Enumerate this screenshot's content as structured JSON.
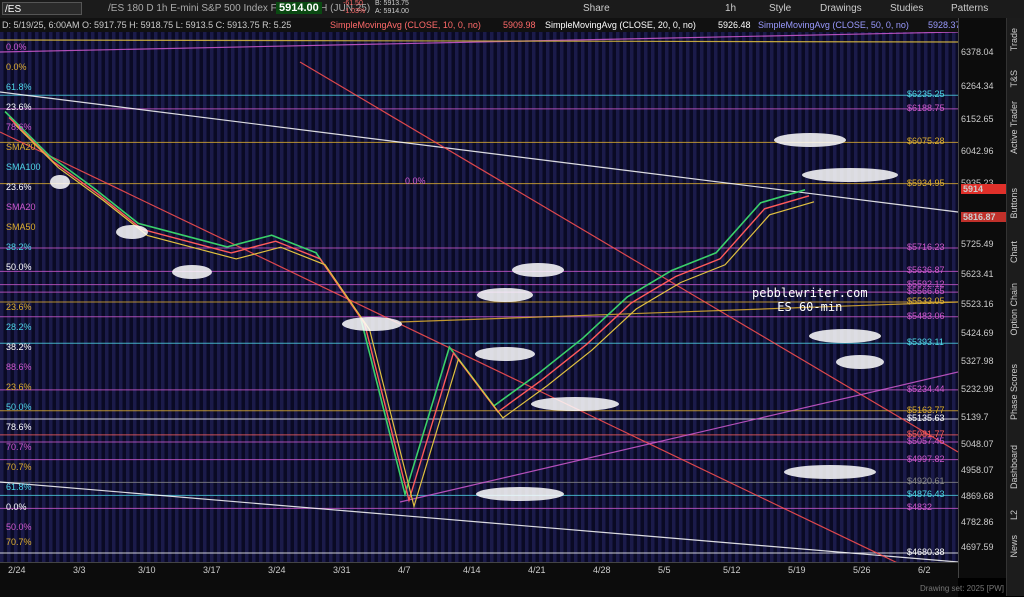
{
  "toolbar": {
    "symbol": "/ES",
    "description": "/ES 180 D 1h  E-mini S&P 500 Index Futures,ETH (JUN 25)",
    "last": "5914.00",
    "change": "-61.50",
    "change_pct": "-1.03%",
    "bid": "B: 5913.75",
    "ask": "A: 5914.00",
    "buttons": [
      "Share",
      "1h",
      "Style",
      "Drawings",
      "Studies",
      "Patterns"
    ]
  },
  "legend": {
    "ohlc": "D: 5/19/25, 6:00AM  O: 5917.75  H: 5918.75  L: 5913.5  C: 5913.75  R: 5.25",
    "sma10": "SimpleMovingAvg (CLOSE, 10, 0, no)",
    "sma10_val": "5909.98",
    "sma20": "SimpleMovingAvg (CLOSE, 20, 0, no)",
    "sma20_val": "5926.48",
    "sma50": "SimpleMovingAvg (CLOSE, 50, 0, no)",
    "sma50_val": "5928.37"
  },
  "chart_data": {
    "type": "line",
    "title": "/ES 180 D 1h",
    "x_ticks": [
      "2/24",
      "3/3",
      "3/10",
      "3/17",
      "3/24",
      "3/31",
      "4/7",
      "4/14",
      "4/21",
      "4/28",
      "5/5",
      "5/12",
      "5/19",
      "5/26",
      "6/2"
    ],
    "y_ticks": [
      "6378.04",
      "6264.34",
      "6152.65",
      "6042.96",
      "5935.23",
      "5725.49",
      "5623.41",
      "5523.16",
      "5424.69",
      "5327.98",
      "5232.99",
      "5139.7",
      "5048.07",
      "4958.07",
      "4869.68",
      "4782.86",
      "4697.59"
    ],
    "ylim": [
      4650,
      6450
    ],
    "series": [
      {
        "values": [
          6180,
          6030,
          5920,
          5800,
          5760,
          5720,
          5760,
          5700,
          5480,
          4880,
          5380,
          5180,
          5290,
          5410,
          5550,
          5640,
          5700,
          5870,
          5914
        ]
      }
    ],
    "levels": [
      {
        "label": "$6235.25",
        "value": 6235.25,
        "color": "#4fd6e8"
      },
      {
        "label": "$6188.75",
        "value": 6188.75,
        "color": "#d05ad0"
      },
      {
        "label": "$6075.28",
        "value": 6075.28,
        "color": "#e0b030"
      },
      {
        "label": "$5934.95",
        "value": 5934.95,
        "color": "#e0b030"
      },
      {
        "label": "$5716.23",
        "value": 5716.23,
        "color": "#d05ad0"
      },
      {
        "label": "$5636.87",
        "value": 5636.87,
        "color": "#d05ad0"
      },
      {
        "label": "$5592.12",
        "value": 5592.12,
        "color": "#d05ad0"
      },
      {
        "label": "$5566.65",
        "value": 5566.65,
        "color": "#d05ad0"
      },
      {
        "label": "$5533.05",
        "value": 5533.05,
        "color": "#e0b030"
      },
      {
        "label": "$5483.06",
        "value": 5483.06,
        "color": "#d05ad0"
      },
      {
        "label": "$5393.11",
        "value": 5393.11,
        "color": "#4fd6e8"
      },
      {
        "label": "$5234.44",
        "value": 5234.44,
        "color": "#d05ad0"
      },
      {
        "label": "$5163.77",
        "value": 5163.77,
        "color": "#e0b030"
      },
      {
        "label": "$5135.63",
        "value": 5135.63,
        "color": "#ffffff"
      },
      {
        "label": "$5081.77",
        "value": 5081.77,
        "color": "#ff6060"
      },
      {
        "label": "$5057.45",
        "value": 5057.45,
        "color": "#d05ad0"
      },
      {
        "label": "$4997.82",
        "value": 4997.82,
        "color": "#d05ad0"
      },
      {
        "label": "$4920.61",
        "value": 4920.61,
        "color": "#888888"
      },
      {
        "label": "$4876.43",
        "value": 4876.43,
        "color": "#4fd6e8"
      },
      {
        "label": "$4832",
        "value": 4832,
        "color": "#d05ad0"
      },
      {
        "label": "$4680.38",
        "value": 4680.38,
        "color": "#ffffff"
      }
    ],
    "fib_labels": [
      "0.0%",
      "0.0%",
      "61.8%",
      "23.6%",
      "78.6%",
      "SMA20",
      "SMA100",
      "23.6%",
      "SMA20",
      "SMA50",
      "38.2%",
      "50.0%",
      "0.0%",
      "23.6%",
      "28.2%",
      "38.2%",
      "88.6%",
      "23.6%",
      "50.0%",
      "78.6%",
      "70.7%",
      "70.7%",
      "61.8%",
      "0.0%",
      "50.0%",
      "70.7%"
    ],
    "price_tags": [
      {
        "label": "5914",
        "value": 5914,
        "color": "#e0302a"
      },
      {
        "label": "5816.87",
        "value": 5816.87,
        "color": "#c0302a"
      }
    ],
    "watermark": [
      "pebblewriter.com",
      "ES 60-min"
    ]
  },
  "side_tabs": [
    "Trade",
    "T&S",
    "Active Trader",
    "Buttons",
    "Chart",
    "Option Chain",
    "Phase Scores",
    "Dashboard",
    "L2",
    "News"
  ],
  "footer": "Drawing set: 2025 [PW]"
}
